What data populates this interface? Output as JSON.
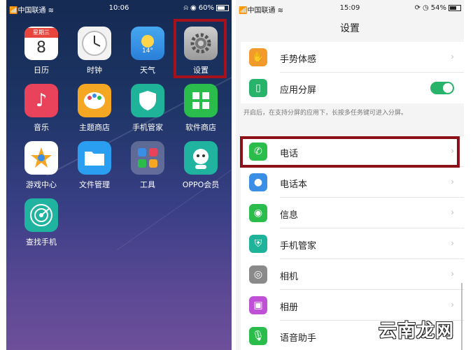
{
  "home": {
    "status": {
      "carrier": "中国联通",
      "time": "10:06",
      "battery": "60%"
    },
    "apps": [
      {
        "label": "日历",
        "icon": "calendar-icon",
        "sub": "星期三",
        "day": "8"
      },
      {
        "label": "时钟",
        "icon": "clock-icon"
      },
      {
        "label": "天气",
        "icon": "weather-icon",
        "temp": "14°"
      },
      {
        "label": "设置",
        "icon": "gear-icon"
      },
      {
        "label": "音乐",
        "icon": "music-note-icon"
      },
      {
        "label": "主题商店",
        "icon": "palette-icon"
      },
      {
        "label": "手机管家",
        "icon": "shield-icon"
      },
      {
        "label": "软件商店",
        "icon": "app-store-icon"
      },
      {
        "label": "游戏中心",
        "icon": "game-star-icon"
      },
      {
        "label": "文件管理",
        "icon": "folder-icon"
      },
      {
        "label": "工具",
        "icon": "tools-folder-icon"
      },
      {
        "label": "OPPO会员",
        "icon": "member-avatar-icon"
      },
      {
        "label": "查找手机",
        "icon": "radar-icon"
      }
    ]
  },
  "settings": {
    "status": {
      "carrier": "中国联通",
      "time": "15:09",
      "battery": "54%"
    },
    "title": "设置",
    "top_rows": [
      {
        "label": "手势体感",
        "icon": "gesture-hand-icon",
        "color": "#f39a2d"
      },
      {
        "label": "应用分屏",
        "icon": "split-screen-icon",
        "color": "#27b36a",
        "toggle": "on"
      }
    ],
    "note": "开启后，在支持分屏的应用下，长按多任务键可进入分屏。",
    "rows": [
      {
        "label": "电话",
        "icon": "phone-icon",
        "color": "#2bbd4b"
      },
      {
        "label": "电话本",
        "icon": "contacts-icon",
        "color": "#3a8ee6"
      },
      {
        "label": "信息",
        "icon": "message-icon",
        "color": "#2bbd4b"
      },
      {
        "label": "手机管家",
        "icon": "shield-icon",
        "color": "#1fb39a"
      },
      {
        "label": "相机",
        "icon": "camera-icon",
        "color": "#8a8a8a"
      },
      {
        "label": "相册",
        "icon": "gallery-icon",
        "color": "#c050d6"
      },
      {
        "label": "语音助手",
        "icon": "microphone-icon",
        "color": "#2bbd4b"
      }
    ]
  },
  "watermark": "云南龙网",
  "colors": {
    "highlight": "#a6111b",
    "toggle_on": "#27b36a"
  }
}
